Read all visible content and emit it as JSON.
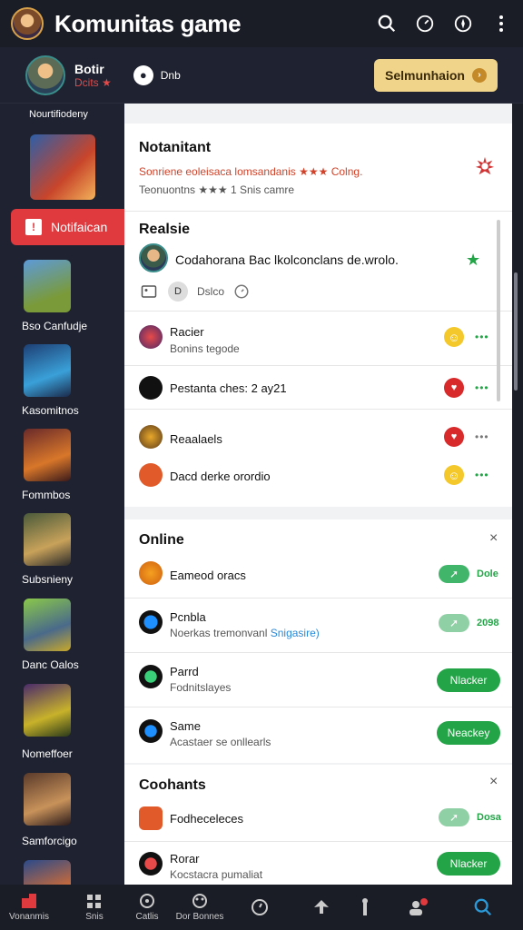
{
  "app": {
    "title": "Komunitas game",
    "accent": "#e0393e",
    "icons": [
      "search-icon",
      "speedometer-icon",
      "compass-icon",
      "more-vertical-icon"
    ]
  },
  "profile": {
    "name": "Botir",
    "sub": "Dcits ★",
    "extra": "Dnb",
    "button_label": "Selmunhaion"
  },
  "sidebar": {
    "top_label": "Nourtifiodeny",
    "notif_tab_label": "Notifaican",
    "items": [
      {
        "label": "Bso Canfudje"
      },
      {
        "label": "Kasomitnos"
      },
      {
        "label": "Fommbos"
      },
      {
        "label": "Subsnieny"
      },
      {
        "label": "Danc Oalos"
      },
      {
        "label": "Nomeffoer"
      },
      {
        "label": "Samforcigo"
      }
    ]
  },
  "notif_card": {
    "title": "Notanitant",
    "line1": "Sonriene eoleisaca lomsandanis ★★★ Colng.",
    "line2": "Teonuontns ★★★ 1 Snis camre"
  },
  "realtime_card": {
    "title": "Realsie",
    "main_text": "Codahorana Bac lkolconclans de.wrolo.",
    "meta": "Dslco",
    "rows": [
      {
        "title": "Racier",
        "sub": "Bonins tegode"
      },
      {
        "title": "Pestanta ches: 2 ay21",
        "sub": ""
      },
      {
        "title": "Reaalaels",
        "sub": ""
      },
      {
        "title": "Dacd derke orordio",
        "sub": ""
      }
    ]
  },
  "online_card": {
    "title": "Online",
    "rows": [
      {
        "title": "Eameod oracs",
        "sub": "",
        "value": "Dole",
        "button": ""
      },
      {
        "title": "Pcnbla",
        "sub": "Noerkas tremonvanl",
        "highlight": "Snigasire)",
        "value": "2098",
        "button": ""
      },
      {
        "title": "Parrd",
        "sub": "Fodnitslayes",
        "value": "",
        "button": "Nlacker"
      },
      {
        "title": "Same",
        "sub": "Acastaer se onllearls",
        "value": "",
        "button": "Neackey"
      }
    ]
  },
  "contacts_card": {
    "title": "Coohants",
    "rows": [
      {
        "title": "Fodheceleces",
        "sub": "",
        "value": "Dosa",
        "button": ""
      },
      {
        "title": "Rorar",
        "sub": "Kocstacra pumaliat",
        "value": "",
        "button": "Nlacker"
      }
    ]
  },
  "bottom_nav": [
    {
      "label": "Vonanmis"
    },
    {
      "label": "Snis"
    },
    {
      "label": "Catlis"
    },
    {
      "label": "Dor Bonnes"
    },
    {
      "label": ""
    },
    {
      "label": ""
    },
    {
      "label": ""
    },
    {
      "label": ""
    },
    {
      "label": ""
    }
  ]
}
